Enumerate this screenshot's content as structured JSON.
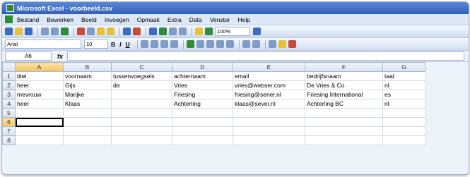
{
  "window": {
    "title": "Microsoft Excel - voorbeeld.csv"
  },
  "menu": [
    "Bestand",
    "Bewerken",
    "Beeld",
    "Invoegen",
    "Opmaak",
    "Extra",
    "Data",
    "Venster",
    "Help"
  ],
  "toolbar": {
    "zoom": "100%"
  },
  "formatting": {
    "font_name": "Arial",
    "font_size": "10",
    "bold": "B",
    "italic": "I",
    "underline": "U"
  },
  "formula_bar": {
    "name_box": "A6",
    "fx_label": "fx",
    "content": ""
  },
  "columns": [
    "A",
    "B",
    "C",
    "D",
    "E",
    "F",
    "G"
  ],
  "active_column": "A",
  "active_row": "6",
  "rows": [
    {
      "num": "1",
      "cells": [
        "titel",
        "voornaam",
        "tussenvoegsels",
        "achternaam",
        "email",
        "bedrijfsnaam",
        "taal"
      ]
    },
    {
      "num": "2",
      "cells": [
        "heer",
        "Gijs",
        "de",
        "Vries",
        "vries@webser.com",
        "De Vries & Co",
        "nl"
      ]
    },
    {
      "num": "3",
      "cells": [
        "mevrouw",
        "Marijke",
        "",
        "Friesing",
        "friesing@sener.nl",
        "Friesing International",
        "es"
      ]
    },
    {
      "num": "4",
      "cells": [
        "heer",
        "Klaas",
        "",
        "Achterling",
        "klaas@sever.nl",
        "Achterling BC",
        "nl"
      ]
    },
    {
      "num": "5",
      "cells": [
        "",
        "",
        "",
        "",
        "",
        "",
        ""
      ]
    },
    {
      "num": "6",
      "cells": [
        "",
        "",
        "",
        "",
        "",
        "",
        ""
      ]
    },
    {
      "num": "7",
      "cells": [
        "",
        "",
        "",
        "",
        "",
        "",
        ""
      ]
    },
    {
      "num": "8",
      "cells": [
        "",
        "",
        "",
        "",
        "",
        "",
        ""
      ]
    }
  ]
}
